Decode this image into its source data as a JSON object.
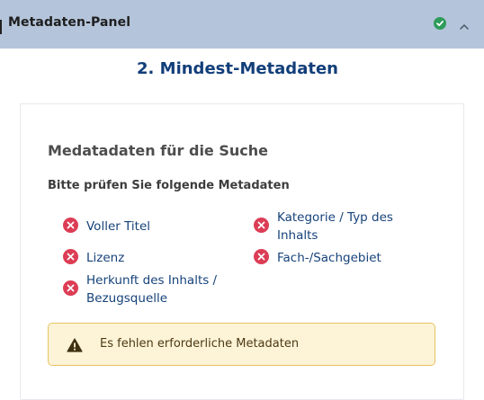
{
  "panel": {
    "title": "Metadaten-Panel",
    "status_icon": "check-circle-icon",
    "collapse_icon": "chevron-up-icon"
  },
  "section": {
    "heading": "2. Mindest-Metadaten"
  },
  "card": {
    "title": "Medatadaten für die Suche",
    "subtitle": "Bitte prüfen Sie folgende Metadaten",
    "items": [
      {
        "line1": "Voller Titel",
        "line2": "",
        "status": "missing"
      },
      {
        "line1": "Kategorie / Typ des",
        "line2": "Inhalts",
        "status": "missing"
      },
      {
        "line1": "Lizenz",
        "line2": "",
        "status": "missing"
      },
      {
        "line1": "Fach-/Sachgebiet",
        "line2": "",
        "status": "missing"
      },
      {
        "line1": "Herkunft des Inhalts /",
        "line2": "Bezugsquelle",
        "status": "missing"
      }
    ]
  },
  "warning": {
    "icon": "warning-triangle-icon",
    "text": "Es fehlen erforderliche Metadaten"
  },
  "colors": {
    "header_bg": "#b4c4da",
    "heading": "#123e7a",
    "error": "#dc3d55",
    "success": "#2e9c5a",
    "warning_bg": "#fdf3d6",
    "warning_border": "#e7c363"
  }
}
